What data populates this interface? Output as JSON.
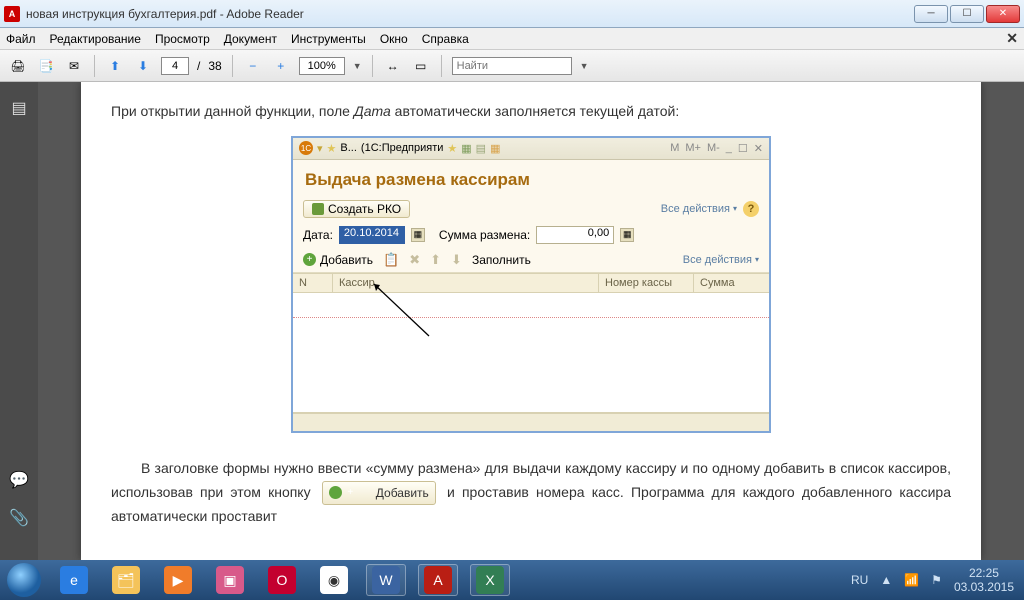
{
  "window": {
    "title": "новая инструкция бухгалтерия.pdf - Adobe Reader"
  },
  "menu": {
    "file": "Файл",
    "edit": "Редактирование",
    "view": "Просмотр",
    "document": "Документ",
    "tools": "Инструменты",
    "window": "Окно",
    "help": "Справка"
  },
  "toolbar": {
    "cur_page": "4",
    "page_sep": "/",
    "total_pages": "38",
    "zoom": "100%",
    "find_placeholder": "Найти"
  },
  "doc": {
    "paragraph1_pre": "При открытии данной функции, поле ",
    "paragraph1_italic": "Дата",
    "paragraph1_post": " автоматически заполняется текущей датой:",
    "paragraph2": "В заголовке формы нужно ввести «сумму размена» для выдачи каждому кассиру и по одному добавить в список кассиров, использовав при этом кнопку ",
    "paragraph2_tail": " и проставив номера касс. Программа для каждого добавленного кассира автоматически проставит",
    "inline_add": "Добавить"
  },
  "oc": {
    "title_prefix": "В...",
    "title_mid": "(1С:Предприяти",
    "heading": "Выдача размена кассирам",
    "create_pko": "Создать РКО",
    "all_actions": "Все действия",
    "date_label": "Дата:",
    "date_value": "20.10.2014",
    "amount_label": "Сумма размена:",
    "amount_value": "0,00",
    "add_label": "Добавить",
    "fill_label": "Заполнить",
    "col_n": "N",
    "col_cashier": "Кассир",
    "col_kassa": "Номер кассы",
    "col_sum": "Сумма",
    "m": "M",
    "mplus": "M+",
    "mminus": "M-"
  },
  "tray": {
    "lang": "RU",
    "time": "22:25",
    "date": "03.03.2015"
  },
  "colors": {
    "oc_accent": "#a66b0f"
  }
}
